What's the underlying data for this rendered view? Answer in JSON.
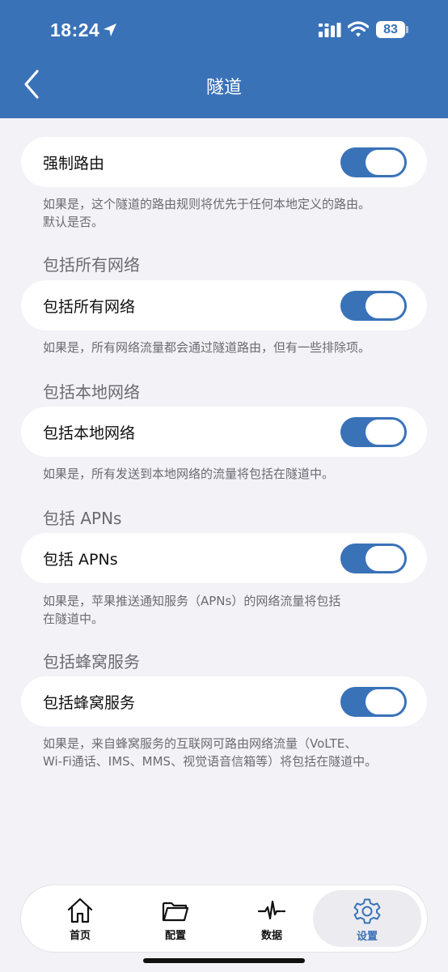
{
  "status_bar": {
    "time": "18:24",
    "battery": "83"
  },
  "nav": {
    "title": "隧道"
  },
  "cards": [
    {
      "label": "强制路由",
      "on": true
    },
    {
      "label": "包括所有网络",
      "on": true
    },
    {
      "label": "包括本地网络",
      "on": true
    },
    {
      "label": "包括 APNs",
      "on": true
    },
    {
      "label": "包括蜂窝服务",
      "on": true
    }
  ],
  "descriptions": {
    "force_route": [
      "如果是，这个隧道的路由规则将优先于任何本地定义的路由。",
      "默认是否。"
    ],
    "all_networks": "如果是，所有网络流量都会通过隧道路由，但有一些排除项。",
    "local_network": "如果是，所有发送到本地网络的流量将包括在隧道中。",
    "apns": [
      "如果是，苹果推送通知服务（APNs）的网络流量将包括",
      "在隧道中。"
    ],
    "cellular": [
      "如果是，来自蜂窝服务的互联网可路由网络流量（VoLTE、",
      "Wi-Fi通话、IMS、MMS、视觉语音信箱等）将包括在隧道中。"
    ]
  },
  "sections": {
    "all_networks": "包括所有网络",
    "local_network": "包括本地网络",
    "apns": "包括 APNs",
    "cellular": "包括蜂窝服务"
  },
  "tabs": [
    {
      "label": "首页",
      "icon": "home-icon"
    },
    {
      "label": "配置",
      "icon": "folder-icon"
    },
    {
      "label": "数据",
      "icon": "pulse-icon"
    },
    {
      "label": "设置",
      "icon": "gear-icon",
      "active": true
    }
  ],
  "colors": {
    "accent": "#3a72b8",
    "background": "#f2f2f7",
    "secondary_text": "#6b6b70"
  }
}
